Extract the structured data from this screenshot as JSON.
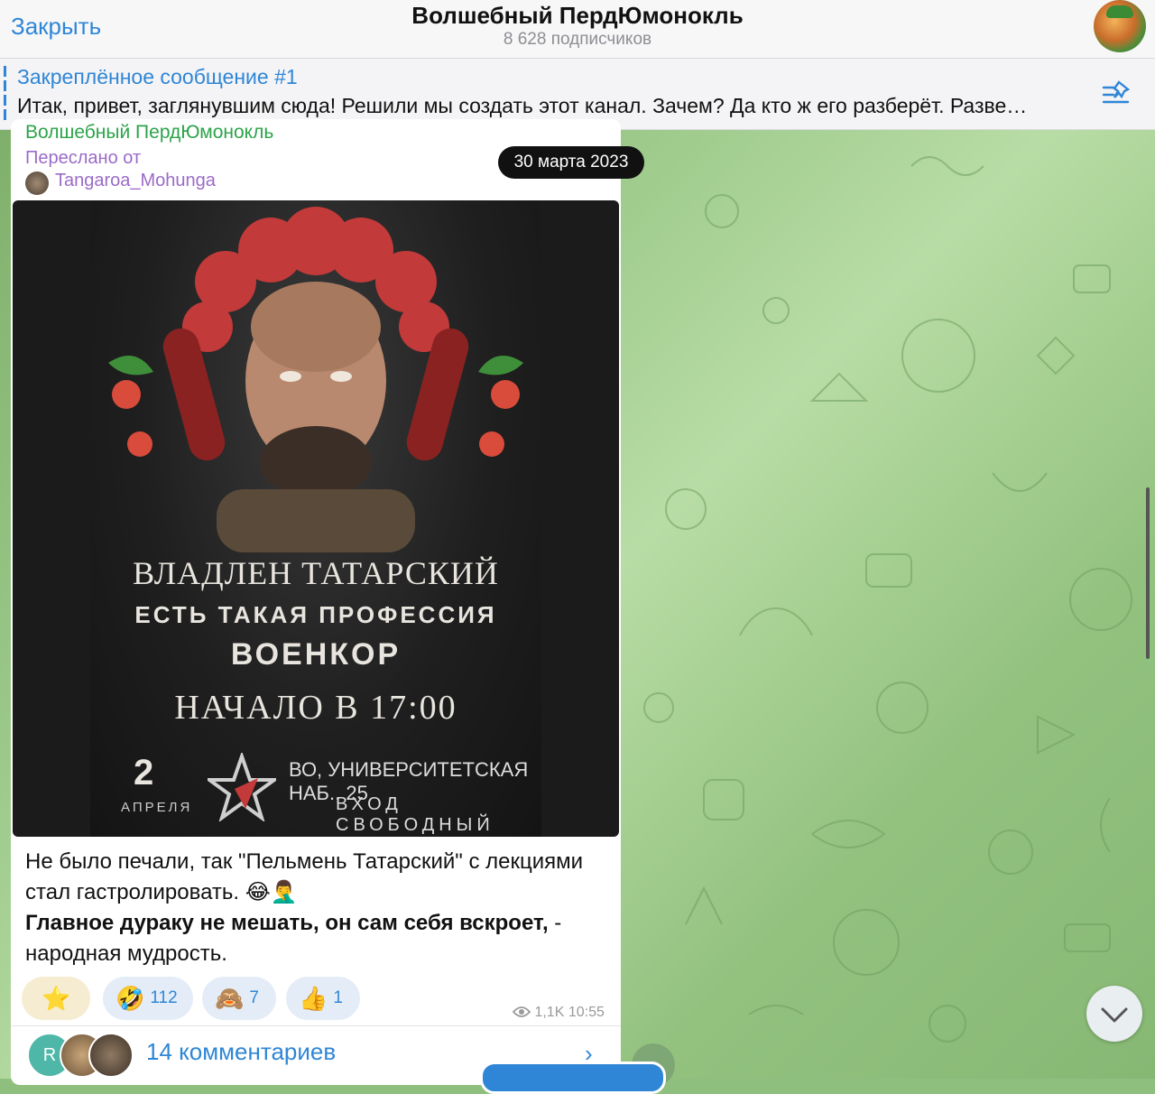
{
  "header": {
    "close_label": "Закрыть",
    "title": "Волшебный ПердЮмонокль",
    "subscribers": "8 628 подписчиков"
  },
  "pinned": {
    "title": "Закреплённое сообщение #1",
    "text": "Итак, привет, заглянувшим сюда! Решили мы создать этот канал. Зачем? Да кто ж его разберёт. Разве…"
  },
  "date_pill": "30 марта 2023",
  "message": {
    "channel_name": "Волшебный ПердЮмонокль",
    "forwarded_label": "Переслано от",
    "forwarded_from": "Tangaroa_Mohunga",
    "poster": {
      "name": "ВЛАДЛЕН ТАТАРСКИЙ",
      "tagline": "ЕСТЬ ТАКАЯ ПРОФЕССИЯ",
      "role": "ВОЕНКОР",
      "start_time": "НАЧАЛО В 17:00",
      "day": "2",
      "month": "АПРЕЛЯ",
      "address": "ВО, УНИВЕРСИТЕТСКАЯ НАБ., 25",
      "entry": "ВХОД СВОБОДНЫЙ"
    },
    "text_line1": "Не было печали, так \"Пельмень Татарский\" с лекциями стал гастролировать. 😂🤦‍♂️",
    "text_bold": "Главное дураку не мешать, он сам себя вскроет,",
    "text_tail": " - народная мудрость.",
    "reactions": [
      {
        "emoji": "⭐",
        "count": ""
      },
      {
        "emoji": "🤣",
        "count": "112"
      },
      {
        "emoji": "🙈",
        "count": "7"
      },
      {
        "emoji": "👍",
        "count": "1"
      }
    ],
    "views": "1,1K",
    "time": "10:55",
    "commenter_initial": "R",
    "comments_label": "14 комментариев"
  },
  "colors": {
    "accent": "#2f86d6",
    "channel_green": "#2ca44a",
    "forward_purple": "#9b6bc8"
  }
}
